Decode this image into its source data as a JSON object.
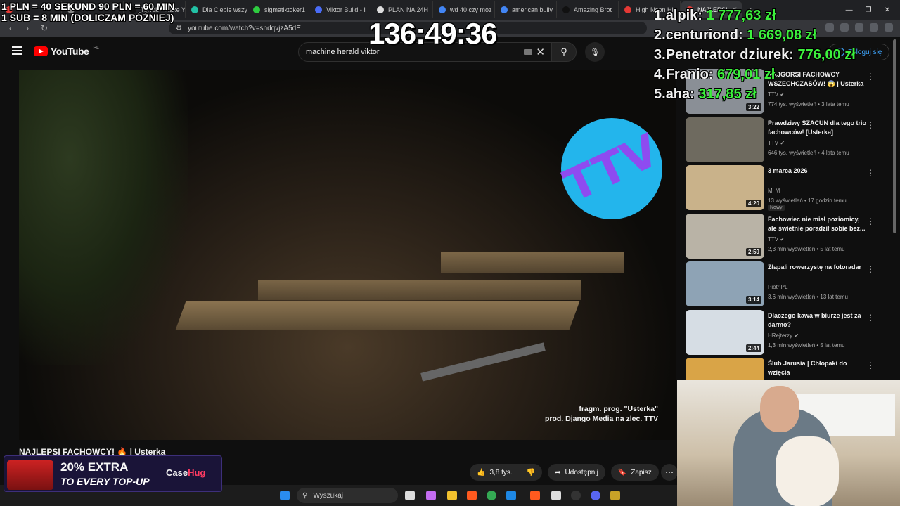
{
  "browser": {
    "tabs": [
      {
        "label": "",
        "color": "#e53935"
      },
      {
        "label": "",
        "color": "#888888"
      },
      {
        "label": "TikTok - Make Y",
        "color": "#111111"
      },
      {
        "label": "Dla Ciebie wszy",
        "color": "#22c1a5"
      },
      {
        "label": "sigmatiktoker1",
        "color": "#2ecc40"
      },
      {
        "label": "Viktor Build - I",
        "color": "#4a6cf7"
      },
      {
        "label": "PLAN NA 24H",
        "color": "#dddddd"
      },
      {
        "label": "wd 40 czy moz",
        "color": "#4285f4"
      },
      {
        "label": "american bully",
        "color": "#4285f4"
      },
      {
        "label": "Amazing Brot",
        "color": "#111111"
      },
      {
        "label": "High Noon Hi",
        "color": "#e53935"
      },
      {
        "label": "NAJLEPSI",
        "color": "#e53935"
      }
    ],
    "new_tab": "+",
    "url": "youtube.com/watch?v=sndqvjzA5dE"
  },
  "youtube": {
    "logo_text": "YouTube",
    "country": "PL",
    "search_query": "machine herald viktor",
    "sign_in": "Zaloguj się"
  },
  "video": {
    "credit_line1": "fragm. prog. \"Usterka\"",
    "credit_line2": "prod. Django Media na zlec. TTV",
    "logo_text": "TTV",
    "title": "NAJLEPSI FACHOWCY! 🔥 | Usterka",
    "likes": "3,8 tys.",
    "share": "Udostępnij",
    "save": "Zapisz"
  },
  "recommendations": [
    {
      "title": "NAJGORSI FACHOWCY WSZECHCZASÓW! 😱 | Usterka",
      "channel": "TTV",
      "meta": "774 tys. wyświetleń • 3 lata temu",
      "duration": "3:22",
      "thumb": "#8a8f96"
    },
    {
      "title": "Prawdziwy SZACUN dla tego trio fachowców! [Usterka]",
      "channel": "TTV",
      "meta": "646 tys. wyświetleń • 4 lata temu",
      "duration": "",
      "thumb": "#6e6a5f"
    },
    {
      "title": "3 marca 2026",
      "channel": "Mi M",
      "meta": "13 wyświetleń • 17 godzin temu",
      "duration": "4:20",
      "badge": "Nowy",
      "thumb": "#c9b28a"
    },
    {
      "title": "Fachowiec nie miał poziomicy, ale świetnie poradził sobie bez...",
      "channel": "TTV",
      "meta": "2,3 mln wyświetleń • 5 lat temu",
      "duration": "2:59",
      "thumb": "#b9b3a6"
    },
    {
      "title": "Złapali rowerzystę na fotoradar",
      "channel": "Piotr PL",
      "meta": "3,6 mln wyświetleń • 13 lat temu",
      "duration": "3:14",
      "thumb": "#8ea3b5"
    },
    {
      "title": "Dlaczego kawa w biurze jest za darmo?",
      "channel": "HRejterzy",
      "meta": "1,3 mln wyświetleń • 5 lat temu",
      "duration": "2:44",
      "thumb": "#d6dde4"
    },
    {
      "title": "Ślub Jarusia | Chłopaki do wzięcia",
      "channel": "",
      "meta": "",
      "duration": "",
      "thumb": "#d9a447"
    }
  ],
  "overlay": {
    "rules_line1": "1 PLN = 40 SEKUND 90 PLN = 60 MIN",
    "rules_line2": "1 SUB = 8 MIN (DOLICZAM PÓŹNIEJ)",
    "timer": "136:49:36",
    "leaderboard": [
      {
        "rank": "1.",
        "name": "alpik:",
        "amount": "1 777,63 zł"
      },
      {
        "rank": "2.",
        "name": "centuriond:",
        "amount": "1 669,08 zł"
      },
      {
        "rank": "3.",
        "name": "Penetrator dziurek:",
        "amount": "776,00 zł"
      },
      {
        "rank": "4.",
        "name": "Franio:",
        "amount": "679,01 zł"
      },
      {
        "rank": "5.",
        "name": "aha:",
        "amount": "317,85 zł"
      }
    ]
  },
  "promo": {
    "headline_pct": "20% EXTRA",
    "subline": "TO EVERY TOP-UP",
    "brand_a": "Case",
    "brand_b": "Hug"
  },
  "taskbar": {
    "search_placeholder": "Wyszukaj"
  }
}
